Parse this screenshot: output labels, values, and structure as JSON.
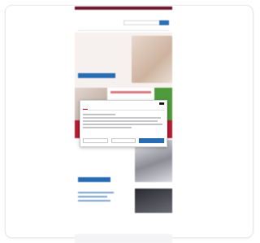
{
  "page": {
    "background": "#ffffff",
    "card_border": "#e6e8eb"
  },
  "site": {
    "logo_text": "",
    "logo_sub": "",
    "hero_title": "",
    "section_title": "",
    "colors": {
      "brand": "#c0202f",
      "topbar": "#6f1930",
      "primary_button": "#2a6cb3",
      "red_band": "#b31e35",
      "green_tile": "#4f9a3c"
    }
  },
  "cookie_dialog": {
    "tabs": [
      {
        "label": ""
      },
      {
        "label": ""
      },
      {
        "label": ""
      }
    ],
    "buttons": {
      "deny": "",
      "settings": "",
      "accept": ""
    },
    "close_icon": "close-icon"
  }
}
